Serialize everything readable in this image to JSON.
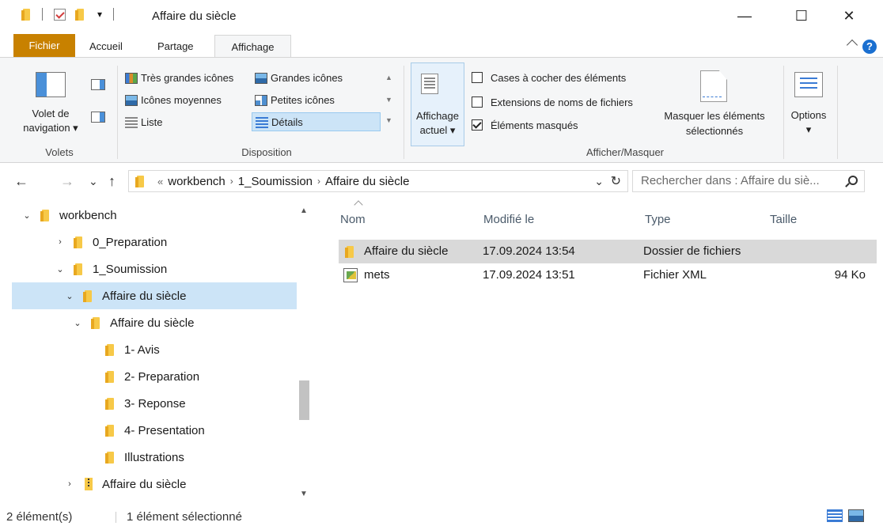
{
  "window": {
    "title": "Affaire du siècle",
    "minimize": "—",
    "maximize": "☐",
    "close": "✕"
  },
  "ribbon_tabs": {
    "file": "Fichier",
    "home": "Accueil",
    "share": "Partage",
    "view": "Affichage",
    "help": "?"
  },
  "ribbon": {
    "panes": {
      "nav_pane_label_1": "Volet de",
      "nav_pane_label_2": "navigation ▾",
      "group_label": "Volets"
    },
    "layout": {
      "items": [
        {
          "label": "Très grandes icônes"
        },
        {
          "label": "Grandes icônes"
        },
        {
          "label": "Icônes moyennes"
        },
        {
          "label": "Petites icônes"
        },
        {
          "label": "Liste"
        },
        {
          "label": "Détails"
        }
      ],
      "group_label": "Disposition"
    },
    "current_view": {
      "label_1": "Affichage",
      "label_2": "actuel ▾"
    },
    "show_hide": {
      "checkboxes": [
        {
          "label": "Cases à cocher des éléments",
          "checked": false
        },
        {
          "label": "Extensions de noms de fichiers",
          "checked": false
        },
        {
          "label": "Éléments masqués",
          "checked": true
        }
      ],
      "hide_selected_1": "Masquer les éléments",
      "hide_selected_2": "sélectionnés",
      "group_label": "Afficher/Masquer"
    },
    "options": {
      "label": "Options",
      "arrow": "▾"
    }
  },
  "address": {
    "back": "←",
    "forward": "→",
    "recent": "⌄",
    "up": "↑",
    "overflow": "«",
    "crumbs": [
      "workbench",
      "1_Soumission",
      "Affaire du siècle"
    ],
    "crumb_sep": "›",
    "dropdown": "⌄",
    "refresh": "↻",
    "search_placeholder": "Rechercher dans : Affaire du siè..."
  },
  "tree": [
    {
      "label": "workbench",
      "chevron": "⌄",
      "depth": 0,
      "selected": false
    },
    {
      "label": "0_Preparation",
      "chevron": "›",
      "depth": 1,
      "selected": false
    },
    {
      "label": "1_Soumission",
      "chevron": "⌄",
      "depth": 1,
      "selected": false
    },
    {
      "label": "Affaire du siècle",
      "chevron": "⌄",
      "depth": 2,
      "selected": true
    },
    {
      "label": "Affaire du siècle",
      "chevron": "⌄",
      "depth": 3,
      "selected": false
    },
    {
      "label": "1- Avis",
      "chevron": "",
      "depth": 4,
      "selected": false
    },
    {
      "label": "2- Preparation",
      "chevron": "",
      "depth": 4,
      "selected": false
    },
    {
      "label": "3- Reponse",
      "chevron": "",
      "depth": 4,
      "selected": false
    },
    {
      "label": "4- Presentation",
      "chevron": "",
      "depth": 4,
      "selected": false
    },
    {
      "label": "Illustrations",
      "chevron": "",
      "depth": 4,
      "selected": false
    },
    {
      "label": "Affaire du siècle",
      "chevron": "›",
      "depth": 2,
      "selected": false,
      "zip": true
    }
  ],
  "columns": {
    "name": "Nom",
    "modified": "Modifié le",
    "type": "Type",
    "size": "Taille"
  },
  "files": [
    {
      "name": "Affaire du siècle",
      "modified": "17.09.2024 13:54",
      "type": "Dossier de fichiers",
      "size": "",
      "kind": "folder",
      "selected": true
    },
    {
      "name": "mets",
      "modified": "17.09.2024 13:51",
      "type": "Fichier XML",
      "size": "94 Ko",
      "kind": "xml",
      "selected": false
    }
  ],
  "status": {
    "count": "2 élément(s)",
    "selection": "1 élément sélectionné"
  },
  "colors": {
    "file_tab": "#c88100",
    "selection": "#cce4f7",
    "folder": "#f7c948",
    "accent": "#1a6fd0"
  }
}
